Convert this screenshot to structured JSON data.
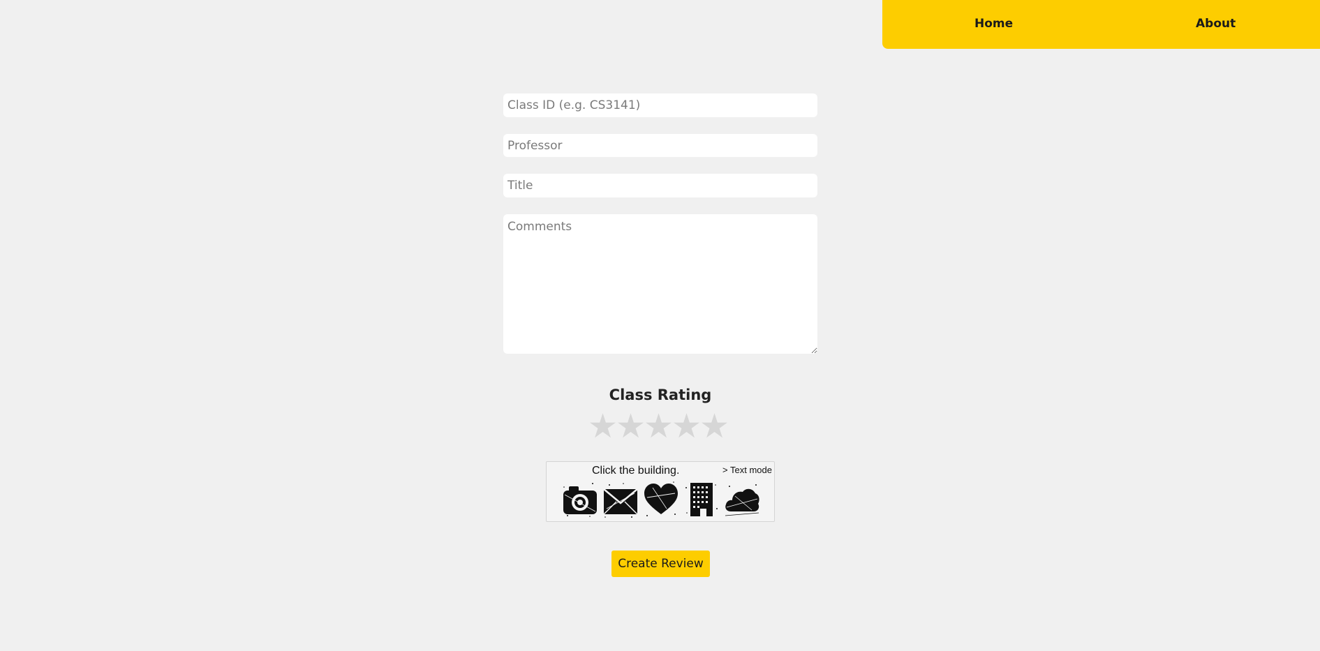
{
  "nav": {
    "home": "Home",
    "about": "About"
  },
  "form": {
    "class_id_placeholder": "Class ID (e.g. CS3141)",
    "professor_placeholder": "Professor",
    "title_placeholder": "Title",
    "comments_placeholder": "Comments",
    "class_id_value": "",
    "professor_value": "",
    "title_value": "",
    "comments_value": ""
  },
  "rating": {
    "title": "Class Rating",
    "max": 5,
    "value": 0,
    "star_glyph": "★",
    "empty_color": "#d6d6d6"
  },
  "captcha": {
    "prompt": "Click the building.",
    "text_mode_link": "> Text mode",
    "icons": [
      "camera-icon",
      "envelope-icon",
      "heart-icon",
      "building-icon",
      "cloud-icon"
    ]
  },
  "submit_label": "Create Review",
  "colors": {
    "accent": "#fdcd00",
    "background": "#f0f0f0"
  }
}
